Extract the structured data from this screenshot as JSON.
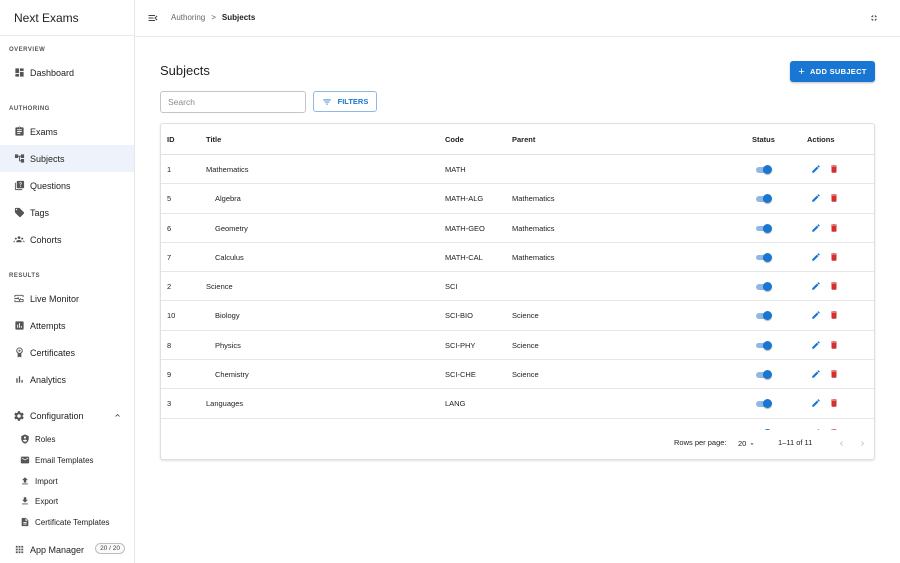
{
  "app": {
    "title": "Next Exams"
  },
  "sidebar": {
    "sections": {
      "overview": "OVERVIEW",
      "authoring": "AUTHORING",
      "results": "RESULTS"
    },
    "items": {
      "dashboard": "Dashboard",
      "exams": "Exams",
      "subjects": "Subjects",
      "questions": "Questions",
      "tags": "Tags",
      "cohorts": "Cohorts",
      "live_monitor": "Live Monitor",
      "attempts": "Attempts",
      "certificates": "Certificates",
      "analytics": "Analytics",
      "configuration": "Configuration"
    },
    "config_items": {
      "roles": "Roles",
      "email_templates": "Email Templates",
      "import": "Import",
      "export": "Export",
      "certificate_templates": "Certificate Templates"
    },
    "app_manager": {
      "label": "App Manager",
      "badge": "20 / 20"
    },
    "active_item": "subjects"
  },
  "topbar": {
    "breadcrumb": {
      "parent": "Authoring",
      "separator": ">",
      "current": "Subjects"
    }
  },
  "main": {
    "title": "Subjects",
    "add_button": "ADD SUBJECT",
    "search": {
      "placeholder": "Search",
      "value": ""
    },
    "filters_button": "FILTERS"
  },
  "table": {
    "columns": {
      "id": "ID",
      "title": "Title",
      "code": "Code",
      "parent": "Parent",
      "status": "Status",
      "actions": "Actions"
    },
    "rows": [
      {
        "id": "1",
        "title": "Mathematics",
        "code": "MATH",
        "parent": "",
        "child": false,
        "status": true
      },
      {
        "id": "5",
        "title": "Algebra",
        "code": "MATH-ALG",
        "parent": "Mathematics",
        "child": true,
        "status": true
      },
      {
        "id": "6",
        "title": "Geometry",
        "code": "MATH-GEO",
        "parent": "Mathematics",
        "child": true,
        "status": true
      },
      {
        "id": "7",
        "title": "Calculus",
        "code": "MATH-CAL",
        "parent": "Mathematics",
        "child": true,
        "status": true
      },
      {
        "id": "2",
        "title": "Science",
        "code": "SCI",
        "parent": "",
        "child": false,
        "status": true
      },
      {
        "id": "10",
        "title": "Biology",
        "code": "SCI-BIO",
        "parent": "Science",
        "child": true,
        "status": true
      },
      {
        "id": "8",
        "title": "Physics",
        "code": "SCI-PHY",
        "parent": "Science",
        "child": true,
        "status": true
      },
      {
        "id": "9",
        "title": "Chemistry",
        "code": "SCI-CHE",
        "parent": "Science",
        "child": true,
        "status": true
      },
      {
        "id": "3",
        "title": "Languages",
        "code": "LANG",
        "parent": "",
        "child": false,
        "status": true
      },
      {
        "id": "",
        "title": "",
        "code": "",
        "parent": "",
        "child": true,
        "status": true
      }
    ],
    "pagination": {
      "rows_per_page_label": "Rows per page:",
      "rows_per_page": "20",
      "range": "1–11 of 11"
    }
  },
  "colors": {
    "primary": "#1976d2",
    "delete": "#d32f2f",
    "active_nav_bg": "#eef3fb"
  }
}
